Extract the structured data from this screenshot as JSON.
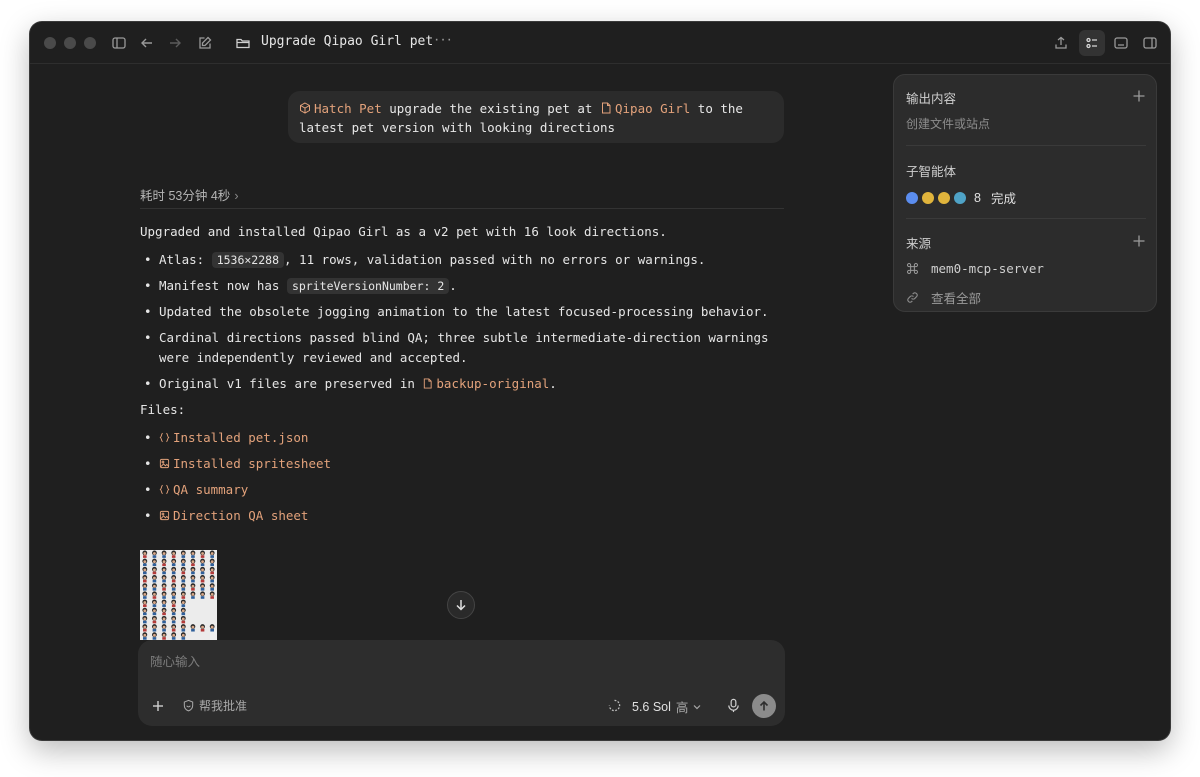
{
  "window": {
    "title": "Upgrade Qipao Girl pet"
  },
  "conversation": {
    "user_message": {
      "chip_skill": "Hatch Pet",
      "text_before_chip": "upgrade the existing pet at",
      "chip_folder": "Qipao Girl",
      "text_after_chip": "to the latest pet version with looking directions"
    },
    "elapsed_label": "耗时 53分钟 4秒",
    "summary": "Upgraded and installed Qipao Girl as a v2 pet with 16 look directions.",
    "bullets": {
      "b1_prefix": "Atlas:",
      "b1_code": "1536×2288",
      "b1_suffix": ", 11 rows, validation passed with no errors or warnings.",
      "b2_prefix": "Manifest now has",
      "b2_code": "spriteVersionNumber: 2",
      "b2_suffix": ".",
      "b3": "Updated the obsolete jogging animation to the latest focused-processing behavior.",
      "b4": "Cardinal directions passed blind QA; three subtle intermediate-direction warnings were independently reviewed and accepted.",
      "b5_prefix": "Original v1 files are preserved in",
      "b5_link": "backup-original",
      "b5_suffix": "."
    },
    "files_heading": "Files:",
    "files": [
      {
        "label": "Installed pet.json",
        "icon": "json-braces-icon"
      },
      {
        "label": "Installed spritesheet",
        "icon": "image-icon"
      },
      {
        "label": "QA summary",
        "icon": "json-braces-icon"
      },
      {
        "label": "Direction QA sheet",
        "icon": "image-icon"
      }
    ]
  },
  "composer": {
    "placeholder": "随心输入",
    "approve_label": "帮我批准",
    "model_label": "5.6 Sol",
    "model_level": "高"
  },
  "side_panel": {
    "output": {
      "title": "输出内容",
      "subtitle": "创建文件或站点"
    },
    "subagents": {
      "title": "子智能体",
      "count": "8",
      "status": "完成",
      "dot_colors": [
        "#5b8def",
        "#e0b43c",
        "#e0b43c",
        "#4fa3c7"
      ]
    },
    "sources": {
      "title": "来源",
      "items": [
        {
          "label": "mem0-mcp-server",
          "icon": "command-icon"
        },
        {
          "label": "查看全部",
          "icon": "link-icon"
        }
      ]
    }
  },
  "colors": {
    "accent_link": "#e3a27b",
    "window_bg": "#1f1f1f",
    "panel_bg": "#2c2c2c"
  }
}
